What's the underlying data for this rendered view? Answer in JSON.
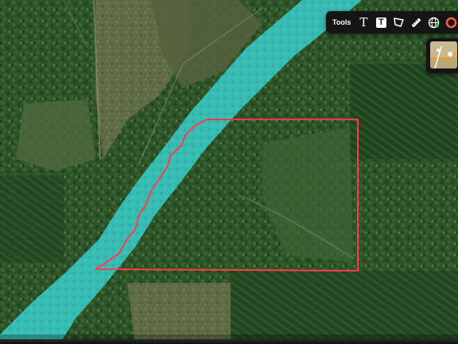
{
  "toolbar": {
    "label": "Tools",
    "text_tool_label": "T",
    "text_box_tool_label": "T",
    "tools": [
      {
        "name": "text-tool",
        "icon": "text-icon"
      },
      {
        "name": "text-box-tool",
        "icon": "text-box-icon"
      },
      {
        "name": "polygon-tool",
        "icon": "polygon-icon"
      },
      {
        "name": "measure-tool",
        "icon": "ruler-icon"
      },
      {
        "name": "globe-tool",
        "icon": "globe-icon"
      },
      {
        "name": "circle-tool",
        "icon": "circle-icon"
      },
      {
        "name": "scissors-tool",
        "icon": "scissors-icon"
      }
    ]
  },
  "layer_thumbnail": {
    "icon": "map-layer-thumbnail"
  },
  "map": {
    "type": "satellite",
    "colors": {
      "river_highlight": "#37c2bb",
      "property_boundary": "#ff3b4a",
      "forest_dark": "#254a22",
      "forest_light": "#3f6a36",
      "clearing": "#6f7a52",
      "toolbar_bg": "#151515"
    }
  }
}
